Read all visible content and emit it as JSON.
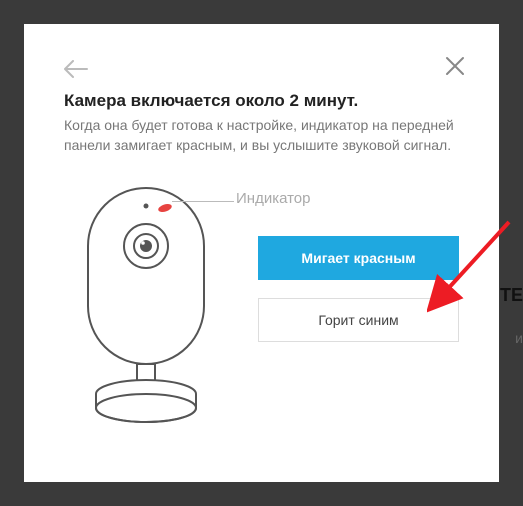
{
  "dialog": {
    "title": "Камера включается около 2 минут.",
    "subtitle": "Когда она будет готова к настройке, индикатор на передней панели замигает красным, и вы услышите звуковой сигнал.",
    "indicator_label": "Индикатор",
    "buttons": {
      "primary": "Мигает красным",
      "secondary": "Горит синим"
    }
  },
  "background": {
    "text1": "ТЕ",
    "text2": "и"
  },
  "colors": {
    "primary_button": "#1fa8e0",
    "indicator_led": "#e74340",
    "annotation_arrow": "#ed1c24"
  }
}
